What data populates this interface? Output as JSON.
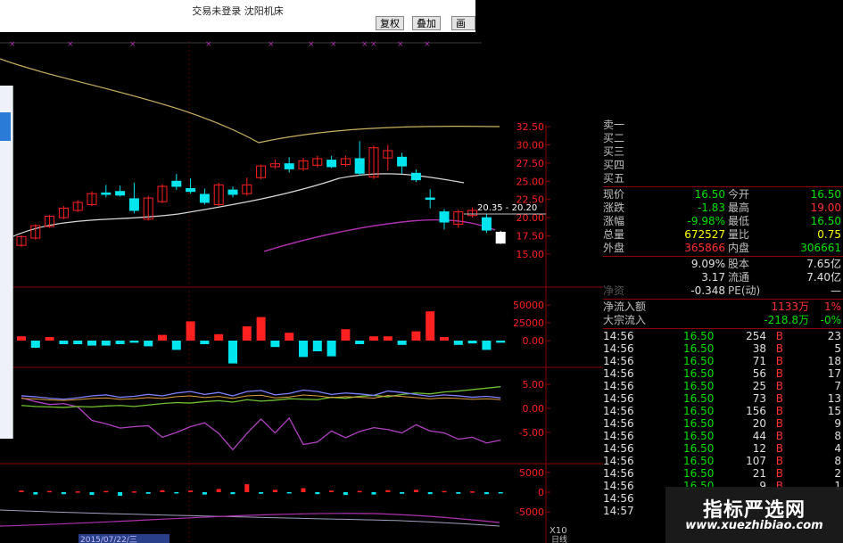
{
  "window": {
    "title": "交易未登录    沈阳机床",
    "buttons": [
      "复权",
      "叠加",
      "画线"
    ]
  },
  "chart_data": {
    "type": "candlestick",
    "price_axis": [
      "32.50",
      "30.00",
      "27.50",
      "25.00",
      "22.50",
      "20.00",
      "17.50",
      "15.00"
    ],
    "price_range": [
      15.0,
      32.5
    ],
    "candles": [
      {
        "o": 16.2,
        "c": 17.4,
        "h": 17.6,
        "l": 16.0,
        "color": "red"
      },
      {
        "o": 17.2,
        "c": 18.9,
        "h": 19.1,
        "l": 17.0,
        "color": "red"
      },
      {
        "o": 18.8,
        "c": 20.2,
        "h": 20.4,
        "l": 18.6,
        "color": "red"
      },
      {
        "o": 20.0,
        "c": 21.3,
        "h": 21.6,
        "l": 19.8,
        "color": "red"
      },
      {
        "o": 21.0,
        "c": 22.1,
        "h": 22.4,
        "l": 20.8,
        "color": "red"
      },
      {
        "o": 21.8,
        "c": 23.3,
        "h": 23.6,
        "l": 21.6,
        "color": "red"
      },
      {
        "o": 23.4,
        "c": 23.2,
        "h": 24.5,
        "l": 22.8,
        "color": "cyan"
      },
      {
        "o": 23.6,
        "c": 23.1,
        "h": 24.4,
        "l": 22.9,
        "color": "cyan"
      },
      {
        "o": 22.6,
        "c": 21.0,
        "h": 24.8,
        "l": 20.6,
        "color": "cyan"
      },
      {
        "o": 19.8,
        "c": 22.7,
        "h": 23.0,
        "l": 19.6,
        "color": "red"
      },
      {
        "o": 22.2,
        "c": 24.3,
        "h": 24.6,
        "l": 22.0,
        "color": "red"
      },
      {
        "o": 25.0,
        "c": 24.3,
        "h": 26.0,
        "l": 23.8,
        "color": "cyan"
      },
      {
        "o": 24.0,
        "c": 23.6,
        "h": 25.4,
        "l": 23.3,
        "color": "cyan"
      },
      {
        "o": 23.2,
        "c": 22.1,
        "h": 24.0,
        "l": 21.8,
        "color": "cyan"
      },
      {
        "o": 21.8,
        "c": 24.5,
        "h": 24.8,
        "l": 21.6,
        "color": "red"
      },
      {
        "o": 23.8,
        "c": 23.2,
        "h": 24.3,
        "l": 22.8,
        "color": "cyan"
      },
      {
        "o": 23.3,
        "c": 24.5,
        "h": 25.5,
        "l": 23.0,
        "color": "red"
      },
      {
        "o": 25.5,
        "c": 27.1,
        "h": 27.3,
        "l": 25.3,
        "color": "red"
      },
      {
        "o": 27.0,
        "c": 27.4,
        "h": 28.0,
        "l": 26.7,
        "color": "red"
      },
      {
        "o": 27.4,
        "c": 26.7,
        "h": 28.3,
        "l": 26.2,
        "color": "cyan"
      },
      {
        "o": 26.7,
        "c": 27.8,
        "h": 28.2,
        "l": 26.4,
        "color": "red"
      },
      {
        "o": 27.2,
        "c": 28.1,
        "h": 28.5,
        "l": 26.9,
        "color": "red"
      },
      {
        "o": 27.9,
        "c": 27.0,
        "h": 28.5,
        "l": 26.8,
        "color": "cyan"
      },
      {
        "o": 27.3,
        "c": 28.1,
        "h": 28.5,
        "l": 27.0,
        "color": "red"
      },
      {
        "o": 28.1,
        "c": 26.1,
        "h": 30.5,
        "l": 25.8,
        "color": "cyan"
      },
      {
        "o": 25.6,
        "c": 29.6,
        "h": 29.9,
        "l": 25.3,
        "color": "red"
      },
      {
        "o": 28.2,
        "c": 29.2,
        "h": 30.0,
        "l": 26.5,
        "color": "red"
      },
      {
        "o": 28.3,
        "c": 27.1,
        "h": 28.9,
        "l": 26.0,
        "color": "cyan"
      },
      {
        "o": 26.1,
        "c": 25.2,
        "h": 26.6,
        "l": 24.9,
        "color": "cyan"
      },
      {
        "o": 22.7,
        "c": 22.7,
        "h": 23.9,
        "l": 21.3,
        "color": "cyan"
      },
      {
        "o": 20.8,
        "c": 19.4,
        "h": 21.2,
        "l": 18.4,
        "color": "cyan"
      },
      {
        "o": 19.1,
        "c": 20.8,
        "h": 21.1,
        "l": 18.6,
        "color": "red"
      },
      {
        "o": 20.3,
        "c": 21.0,
        "h": 21.4,
        "l": 20.0,
        "color": "red"
      },
      {
        "o": 20.0,
        "c": 18.3,
        "h": 20.5,
        "l": 17.9,
        "color": "cyan"
      },
      {
        "o": 18.0,
        "c": 16.5,
        "h": 18.2,
        "l": 16.4,
        "color": "white"
      }
    ],
    "price_label": "20.35 - 20.20",
    "volume_axis": [
      "50000",
      "25000",
      "0.00"
    ],
    "volume_range": [
      -30000,
      60000
    ],
    "volume": [
      6000,
      -10000,
      5000,
      -5000,
      -5000,
      -7000,
      -7000,
      -5000,
      -3000,
      -8000,
      8000,
      -13000,
      27000,
      -5000,
      9000,
      -32000,
      20000,
      33000,
      -9000,
      11000,
      -23000,
      -15000,
      -22000,
      16000,
      -5000,
      6000,
      6000,
      -6000,
      13000,
      41000,
      5000,
      -6000,
      -4000,
      -13000,
      -3000
    ],
    "indicator_axis": [
      "5.00",
      "0.00",
      "-5.00"
    ],
    "indicator_range": [
      -10,
      8
    ],
    "indicator_series": {
      "purple": [
        2.2,
        1.4,
        0.8,
        1.0,
        0.3,
        -2.5,
        -3.2,
        -4.1,
        -3.8,
        -3.6,
        -6.0,
        -5.0,
        -3.8,
        -3.0,
        -5.2,
        -8.6,
        -5.2,
        -2.2,
        -5.1,
        -2.0,
        -7.5,
        -7.0,
        -4.7,
        -6.1,
        -4.8,
        -4.0,
        -4.4,
        -5.1,
        -3.4,
        -4.7,
        -5.1,
        -6.4,
        -6.0,
        -7.2,
        -6.6
      ],
      "green": [
        0.6,
        0.4,
        0.3,
        0.2,
        0.4,
        0.3,
        0.5,
        0.6,
        0.4,
        0.7,
        1.0,
        1.2,
        1.1,
        1.4,
        1.6,
        1.3,
        1.8,
        1.5,
        1.7,
        2.0,
        1.9,
        1.8,
        2.3,
        2.1,
        2.5,
        2.7,
        2.4,
        2.9,
        3.2,
        3.0,
        3.4,
        3.6,
        3.9,
        4.2,
        4.5
      ],
      "cyan": [
        2.6,
        2.4,
        2.1,
        1.9,
        2.2,
        2.6,
        2.8,
        2.3,
        2.5,
        2.9,
        2.6,
        3.2,
        3.5,
        2.9,
        3.3,
        2.6,
        3.5,
        3.7,
        2.8,
        3.1,
        3.8,
        3.5,
        2.9,
        3.2,
        3.0,
        2.7,
        3.6,
        3.3,
        2.9,
        2.5,
        2.8,
        2.6,
        2.3,
        2.5,
        2.2
      ]
    },
    "bottom_axis": [
      "5000",
      "0",
      "-5000"
    ],
    "bottom_range": [
      -9000,
      9000
    ],
    "bottom_bars": [
      400,
      -600,
      300,
      -500,
      200,
      -700,
      300,
      -900,
      200,
      -400,
      500,
      -300,
      400,
      -600,
      800,
      -500,
      2000,
      -400,
      600,
      -300,
      1000,
      -500,
      400,
      -700,
      300,
      -600,
      500,
      -400,
      600,
      -500,
      300,
      -400,
      200,
      -500,
      -300
    ],
    "date_label": "2015/07/22/三",
    "corner_label": "X10",
    "period_label": "日线"
  },
  "quote": {
    "order_book": [
      "卖一",
      "买二",
      "买三",
      "买四",
      "买五"
    ],
    "fields": [
      {
        "l1": "现价",
        "v1": "16.50",
        "c1": "green",
        "l2": "今开",
        "v2": "16.50",
        "c2": "green"
      },
      {
        "l1": "涨跌",
        "v1": "-1.83",
        "c1": "green",
        "l2": "最高",
        "v2": "19.00",
        "c2": "red"
      },
      {
        "l1": "涨幅",
        "v1": "-9.98%",
        "c1": "green",
        "l2": "最低",
        "v2": "16.50",
        "c2": "green"
      },
      {
        "l1": "总量",
        "v1": "672527",
        "c1": "yellow",
        "l2": "量比",
        "v2": "0.75",
        "c2": "yellow"
      },
      {
        "l1": "外盘",
        "v1": "365866",
        "c1": "red",
        "l2": "内盘",
        "v2": "306661",
        "c2": "green"
      }
    ],
    "extra": [
      {
        "v1": "9.09%",
        "l2": "股本",
        "v2": "7.65亿"
      },
      {
        "v1": "3.17",
        "l2": "流通",
        "v2": "7.40亿"
      },
      {
        "l1": "净资",
        "v1": "-0.348",
        "l2": "PE(动)",
        "v2": "—"
      }
    ],
    "flow": [
      {
        "label": "净流入额",
        "value": "1133万",
        "pct": "1%",
        "color": "red"
      },
      {
        "label": "大宗流入",
        "value": "-218.8万",
        "pct": "-0%",
        "color": "green"
      }
    ],
    "ticks": [
      {
        "t": "14:56",
        "p": "16.50",
        "v": "254",
        "s": "B",
        "n": "23"
      },
      {
        "t": "14:56",
        "p": "16.50",
        "v": "38",
        "s": "B",
        "n": "5"
      },
      {
        "t": "14:56",
        "p": "16.50",
        "v": "71",
        "s": "B",
        "n": "18"
      },
      {
        "t": "14:56",
        "p": "16.50",
        "v": "56",
        "s": "B",
        "n": "17"
      },
      {
        "t": "14:56",
        "p": "16.50",
        "v": "25",
        "s": "B",
        "n": "7"
      },
      {
        "t": "14:56",
        "p": "16.50",
        "v": "73",
        "s": "B",
        "n": "13"
      },
      {
        "t": "14:56",
        "p": "16.50",
        "v": "156",
        "s": "B",
        "n": "15"
      },
      {
        "t": "14:56",
        "p": "16.50",
        "v": "20",
        "s": "B",
        "n": "9"
      },
      {
        "t": "14:56",
        "p": "16.50",
        "v": "44",
        "s": "B",
        "n": "8"
      },
      {
        "t": "14:56",
        "p": "16.50",
        "v": "12",
        "s": "B",
        "n": "4"
      },
      {
        "t": "14:56",
        "p": "16.50",
        "v": "107",
        "s": "B",
        "n": "8"
      },
      {
        "t": "14:56",
        "p": "16.50",
        "v": "21",
        "s": "B",
        "n": "2"
      },
      {
        "t": "14:56",
        "p": "16.50",
        "v": "9",
        "s": "B",
        "n": "1"
      },
      {
        "t": "14:56",
        "p": "",
        "v": "",
        "s": "",
        "n": ""
      },
      {
        "t": "14:57",
        "p": "",
        "v": "",
        "s": "",
        "n": ""
      }
    ]
  },
  "watermark": {
    "title": "指标严选网",
    "url": "www.xuezhibiao.com"
  },
  "colors": {
    "up": "#ff2020",
    "down": "#00e5ee",
    "axis": "#8b0000",
    "green": "#00e000",
    "yellow": "#ffff00",
    "red": "#ff3030",
    "purple": "#b030b0"
  }
}
